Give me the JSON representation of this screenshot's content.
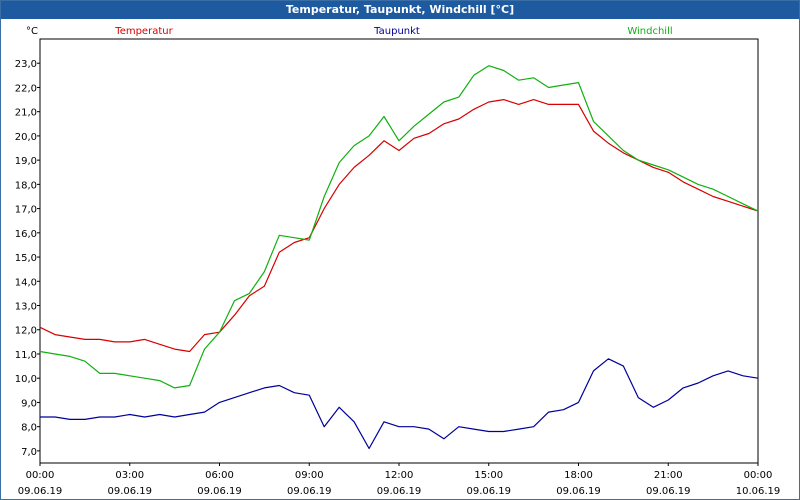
{
  "window": {
    "title": "Temperatur, Taupunkt, Windchill [°C]"
  },
  "chart_data": {
    "type": "line",
    "title": "Temperatur, Taupunkt, Windchill [°C]",
    "ylabel": "°C",
    "ylim": [
      6.5,
      24
    ],
    "yticks": [
      "7,0",
      "8,0",
      "9,0",
      "10,0",
      "11,0",
      "12,0",
      "13,0",
      "14,0",
      "15,0",
      "16,0",
      "17,0",
      "18,0",
      "19,0",
      "20,0",
      "21,0",
      "22,0",
      "23,0"
    ],
    "xlim": [
      0,
      24
    ],
    "xticks": [
      {
        "time": "00:00",
        "date": "09.06.19"
      },
      {
        "time": "03:00",
        "date": "09.06.19"
      },
      {
        "time": "06:00",
        "date": "09.06.19"
      },
      {
        "time": "09:00",
        "date": "09.06.19"
      },
      {
        "time": "12:00",
        "date": "09.06.19"
      },
      {
        "time": "15:00",
        "date": "09.06.19"
      },
      {
        "time": "18:00",
        "date": "09.06.19"
      },
      {
        "time": "21:00",
        "date": "09.06.19"
      },
      {
        "time": "00:00",
        "date": "10.06.19"
      }
    ],
    "grid": true,
    "legend_position": "top",
    "series": [
      {
        "name": "Temperatur",
        "color": "#d80000",
        "x": [
          0,
          0.5,
          1,
          1.5,
          2,
          2.5,
          3,
          3.5,
          4,
          4.5,
          5,
          5.5,
          6,
          6.5,
          7,
          7.5,
          8,
          8.5,
          9,
          9.5,
          10,
          10.5,
          11,
          11.5,
          12,
          12.5,
          13,
          13.5,
          14,
          14.5,
          15,
          15.5,
          16,
          16.5,
          17,
          17.5,
          18,
          18.5,
          19,
          19.5,
          20,
          20.5,
          21,
          21.5,
          22,
          22.5,
          23,
          23.5,
          24
        ],
        "y": [
          12.1,
          11.8,
          11.7,
          11.6,
          11.6,
          11.5,
          11.5,
          11.6,
          11.4,
          11.2,
          11.1,
          11.8,
          11.9,
          12.6,
          13.4,
          13.8,
          15.2,
          15.6,
          15.8,
          17.0,
          18.0,
          18.7,
          19.2,
          19.8,
          19.4,
          19.9,
          20.1,
          20.5,
          20.7,
          21.1,
          21.4,
          21.5,
          21.3,
          21.5,
          21.3,
          21.3,
          21.3,
          20.2,
          19.7,
          19.3,
          19.0,
          18.7,
          18.5,
          18.1,
          17.8,
          17.5,
          17.3,
          17.1,
          16.9
        ]
      },
      {
        "name": "Taupunkt",
        "color": "#00009a",
        "x": [
          0,
          0.5,
          1,
          1.5,
          2,
          2.5,
          3,
          3.5,
          4,
          4.5,
          5,
          5.5,
          6,
          6.5,
          7,
          7.5,
          8,
          8.5,
          9,
          9.5,
          10,
          10.5,
          11,
          11.5,
          12,
          12.5,
          13,
          13.5,
          14,
          14.5,
          15,
          15.5,
          16,
          16.5,
          17,
          17.5,
          18,
          18.5,
          19,
          19.5,
          20,
          20.5,
          21,
          21.5,
          22,
          22.5,
          23,
          23.5,
          24
        ],
        "y": [
          8.4,
          8.4,
          8.3,
          8.3,
          8.4,
          8.4,
          8.5,
          8.4,
          8.5,
          8.4,
          8.5,
          8.6,
          9.0,
          9.2,
          9.4,
          9.6,
          9.7,
          9.4,
          9.3,
          8.0,
          8.8,
          8.2,
          7.1,
          8.2,
          8.0,
          8.0,
          7.9,
          7.5,
          8.0,
          7.9,
          7.8,
          7.8,
          7.9,
          8.0,
          8.6,
          8.7,
          9.0,
          10.3,
          10.8,
          10.5,
          9.2,
          8.8,
          9.1,
          9.6,
          9.8,
          10.1,
          10.3,
          10.1,
          10.0
        ]
      },
      {
        "name": "Windchill",
        "color": "#10b010",
        "x": [
          0,
          0.5,
          1,
          1.5,
          2,
          2.5,
          3,
          3.5,
          4,
          4.5,
          5,
          5.5,
          6,
          6.5,
          7,
          7.5,
          8,
          8.5,
          9,
          9.5,
          10,
          10.5,
          11,
          11.5,
          12,
          12.5,
          13,
          13.5,
          14,
          14.5,
          15,
          15.5,
          16,
          16.5,
          17,
          17.5,
          18,
          18.5,
          19,
          19.5,
          20,
          20.5,
          21,
          21.5,
          22,
          22.5,
          23,
          23.5,
          24
        ],
        "y": [
          11.1,
          11.0,
          10.9,
          10.7,
          10.2,
          10.2,
          10.1,
          10.0,
          9.9,
          9.6,
          9.7,
          11.2,
          11.9,
          13.2,
          13.5,
          14.4,
          15.9,
          15.8,
          15.7,
          17.5,
          18.9,
          19.6,
          20.0,
          20.8,
          19.8,
          20.4,
          20.9,
          21.4,
          21.6,
          22.5,
          22.9,
          22.7,
          22.3,
          22.4,
          22.0,
          22.1,
          22.2,
          20.6,
          20.0,
          19.4,
          19.0,
          18.8,
          18.6,
          18.3,
          18.0,
          17.8,
          17.5,
          17.2,
          16.9
        ]
      }
    ]
  }
}
